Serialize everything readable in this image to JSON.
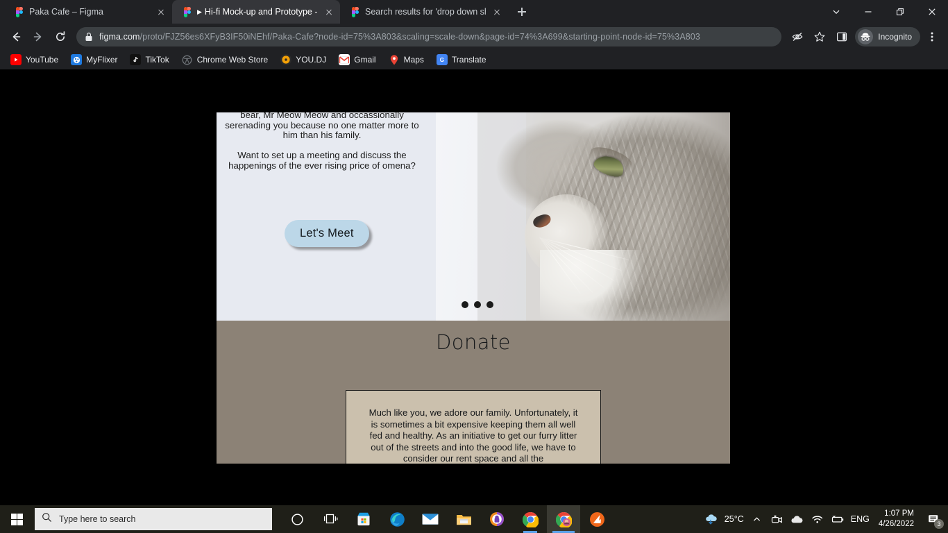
{
  "browser": {
    "tabs": [
      {
        "title": "Paka Cafe – Figma",
        "favicon": "figma-icon",
        "active": false,
        "playing": false
      },
      {
        "title": "Hi-fi Mock-up and Prototype -",
        "favicon": "figma-icon",
        "active": true,
        "playing": true
      },
      {
        "title": "Search results for 'drop down sha",
        "favicon": "figma-icon",
        "active": false,
        "playing": false
      }
    ],
    "new_tab_label": "+",
    "window_controls": [
      "chevron-down-icon",
      "minimize-icon",
      "restore-icon",
      "close-icon"
    ],
    "nav": {
      "back": "back-icon",
      "forward": "forward-icon",
      "reload": "reload-icon"
    },
    "omnibox": {
      "lock": "lock-icon",
      "domain": "figma.com",
      "path": "/proto/FJZ56es6XFyB3IF50iNEhf/Paka-Cafe?node-id=75%3A803&scaling=scale-down&page-id=74%3A699&starting-point-node-id=75%3A803",
      "full_url": "figma.com/proto/FJZ56es6XFyB3IF50iNEhf/Paka-Cafe?node-id=75%3A803&scaling=scale-down&page-id=74%3A699&starting-point-node-id=75%3A803"
    },
    "toolbar_right": {
      "tracking_protection": "eye-slash-icon",
      "bookmark_star": "star-icon",
      "side_panel": "side-panel-icon",
      "profile_label": "Incognito",
      "profile_icon": "incognito-hat-icon",
      "menu": "three-dot-menu-icon"
    },
    "bookmarks": [
      {
        "label": "YouTube",
        "icon": "youtube-icon",
        "color": "#ff0000"
      },
      {
        "label": "MyFlixer",
        "icon": "myflixer-icon",
        "color": "#1f7ae0"
      },
      {
        "label": "TikTok",
        "icon": "tiktok-icon",
        "color": "#010101"
      },
      {
        "label": "Chrome Web Store",
        "icon": "chrome-web-store-icon",
        "color": "#5f6368"
      },
      {
        "label": "YOU.DJ",
        "icon": "youdj-icon",
        "color": "#f0a000"
      },
      {
        "label": "Gmail",
        "icon": "gmail-icon",
        "color": "#ea4335"
      },
      {
        "label": "Maps",
        "icon": "maps-icon",
        "color": "#34a853"
      },
      {
        "label": "Translate",
        "icon": "translate-icon",
        "color": "#4285f4"
      }
    ]
  },
  "prototype": {
    "background_color": "#000000",
    "frame": {
      "hero": {
        "background_color": "#e7eaf1",
        "paragraphs": [
          "long walks on your sofa, cuddling with this trust bear, Mr Meow Meow and occassionally serenading you because no one matter more to him than his family.",
          "Want to set up a meeting and discuss the happenings of the ever rising price of omena?"
        ],
        "cta_label": "Let's Meet",
        "cta_color": "#bcd7e8",
        "carousel_dots": 3,
        "photo_alt": "grey-tabby-cat-profile-photo"
      },
      "donate": {
        "background_color": "#8c8276",
        "heading": "Donate",
        "card_background": "#cbc0ad",
        "card_text": "Much like you, we adore our family. Unfortunately, it is sometimes a bit expensive keeping them all well fed and healthy. As an initiative to get our furry litter out of the streets and into the good life, we have to consider our rent space and all the"
      }
    }
  },
  "taskbar": {
    "start": "windows-start-icon",
    "search_placeholder": "Type here to search",
    "search_icon": "search-icon",
    "apps": [
      {
        "name": "cortana-icon"
      },
      {
        "name": "task-view-icon"
      },
      {
        "name": "microsoft-store-icon"
      },
      {
        "name": "microsoft-edge-icon"
      },
      {
        "name": "mail-icon"
      },
      {
        "name": "file-explorer-icon"
      },
      {
        "name": "password-manager-icon"
      },
      {
        "name": "google-chrome-icon"
      },
      {
        "name": "google-chrome-incognito-icon"
      },
      {
        "name": "avast-icon"
      }
    ],
    "tray": {
      "weather_icon": "cloud-rain-icon",
      "temperature": "25°C",
      "show_hidden": "chevron-up-icon",
      "meet_icon": "camera-icon",
      "onedrive_icon": "cloud-icon",
      "wifi_icon": "wifi-icon",
      "battery_icon": "battery-icon",
      "language": "ENG",
      "time": "1:07 PM",
      "date": "4/26/2022",
      "notification_icon": "notification-icon",
      "notification_count": "3"
    }
  }
}
